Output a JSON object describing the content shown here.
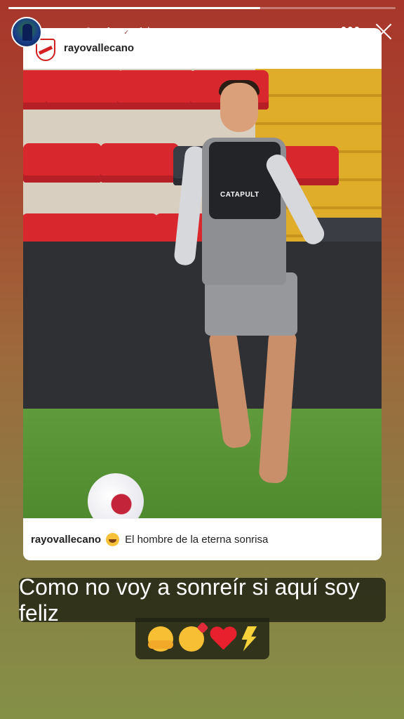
{
  "story": {
    "progress": 0.65,
    "author": "oscar8trejo",
    "verified": "✓",
    "time": "1 h",
    "more_label": "•••",
    "close_label": ""
  },
  "shared_post": {
    "username": "rayovallecano",
    "caption_user": "rayovallecano",
    "caption_text": "El hombre de la eterna sonrisa",
    "vest_sponsor": "CATAPULT"
  },
  "stickers": {
    "line1": "Como no voy a sonreír si aquí soy feliz",
    "emojis": [
      "hugging-face",
      "smiling-face-with-hearts",
      "red-heart",
      "high-voltage"
    ]
  },
  "colors": {
    "story_background_top": "#a8362b",
    "story_background_bottom": "#849046",
    "sticker_background": "#222414",
    "club_red": "#d32020"
  }
}
